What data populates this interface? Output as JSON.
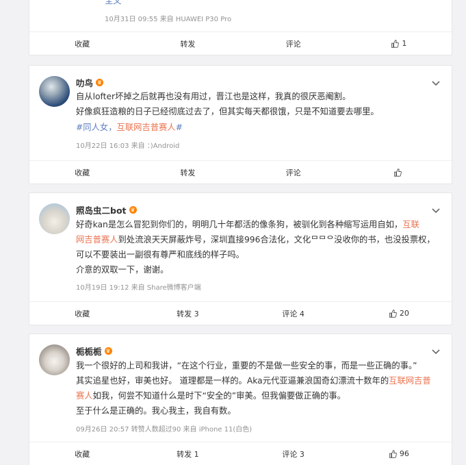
{
  "posts": [
    {
      "partial_top_text": "全文^",
      "meta": "10月31日 09:55  来自 HUAWEI P30 Pro",
      "actions": {
        "fav": "收藏",
        "repost": "转发",
        "comment": "评论",
        "like": "1"
      }
    },
    {
      "username": "叻鸟",
      "lines": [
        "自从lofter坏掉之后就再也没有用过，晋江也是这样，我真的很厌恶阉割。",
        "好像疯狂造粮的日子已经彻底过去了，但其实每天都很饿，只是不知道要去哪里。"
      ],
      "tags": {
        "t1": "#同人女",
        "sep": "，",
        "t2": "互联网吉普赛人",
        "t3": "#"
      },
      "meta": "10月22日 16:03  来自 ：)Android",
      "actions": {
        "fav": "收藏",
        "repost": "转发",
        "comment": "评论",
        "like": ""
      }
    },
    {
      "username": "照岛虫二bot",
      "line1_a": "好奇kan是怎么冒犯到你们的，明明几十年都活的像条狗，被驯化到各种缩写运用自如，",
      "line1_b": "互联",
      "line2_a": "网吉普赛人",
      "line2_b": "到处流浪天天屏蔽炸号，深圳直接996合法化，文化ᄆᄆᄋ没收你的书，也没投票权，",
      "line3": "可以不要装出一副很有尊严和底线的样子吗。",
      "line4": "介意的双取一下，谢谢。",
      "meta": "10月19日 19:12  来自 Share微博客户端",
      "actions": {
        "fav": "收藏",
        "repost": "转发 3",
        "comment": "评论 4",
        "like": "20"
      }
    },
    {
      "username": "栀栀栀",
      "line1": "我一个很好的上司和我讲，“在这个行业，重要的不是做一些安全的事，而是一些正确的事。”",
      "line2_a": "其实追星也好，审美也好。 道理都是一样的。Aka元代亚逼兼浪国奇幻漂流十数年的",
      "line2_b": "互联网吉普",
      "line3_a": "赛人",
      "line3_b": "如我，何尝不知道什么是时下“安全的”审美。但我偏要做正确的事。",
      "line4": "至于什么是正确的。我心我主，我自有数。",
      "meta": "09月26日 20:57  转赞人数超过90  来自 iPhone 11(白色)",
      "actions": {
        "fav": "收藏",
        "repost": "转发 1",
        "comment": "评论 3",
        "like": "96"
      }
    }
  ],
  "colors": {
    "link_red": "#eb7350",
    "link_blue": "#5d7ec0",
    "crown": "#ff8200"
  }
}
